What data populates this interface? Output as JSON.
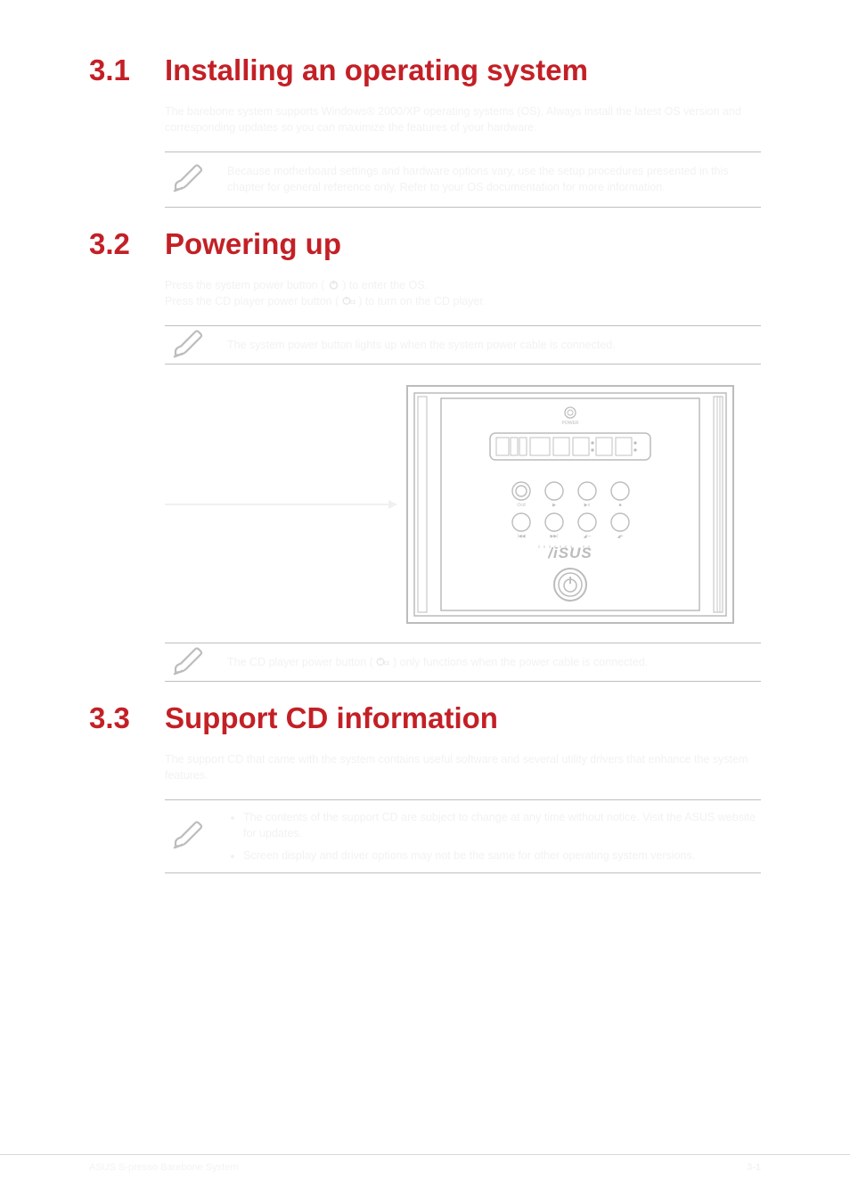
{
  "section1": {
    "num": "3.1",
    "title": "Installing an operating system",
    "body": "The barebone system supports Windows® 2000/XP operating systems (OS). Always install the latest OS version and corresponding updates so you can maximize the features of your hardware.",
    "note": "Because motherboard settings and hardware options vary, use the setup procedures presented in this chapter for general reference only. Refer to your OS documentation for more information."
  },
  "section2": {
    "num": "3.2",
    "title": "Powering up",
    "body1": "Press the system power button (",
    "body2": ") to enter the OS.",
    "body3": "Press the CD player power button (",
    "body4": ") to turn on the CD player.",
    "note1": "The system power button lights up when the system power cable is connected.",
    "note2": "The CD player power button (",
    "note2b": ") only functions when the power cable is connected."
  },
  "section3": {
    "num": "3.3",
    "title": "Support CD information",
    "body": "The support CD that came with the system contains useful software and several utility drivers that enhance the system features.",
    "note": "Screen display and driver options may not be the same for other operating system versions.",
    "note_line1": "The contents of the support CD are subject to change at any time without notice. Visit the ASUS website for updates.",
    "note_line2": "Screen display and driver options may not be the same for other operating system versions."
  },
  "footer": {
    "left": "ASUS S-presso Barebone System",
    "right": "3-1"
  },
  "icons": {
    "power": "power-icon",
    "cd": "cd-power-icon"
  },
  "device": {
    "brand": "/iSUS"
  }
}
